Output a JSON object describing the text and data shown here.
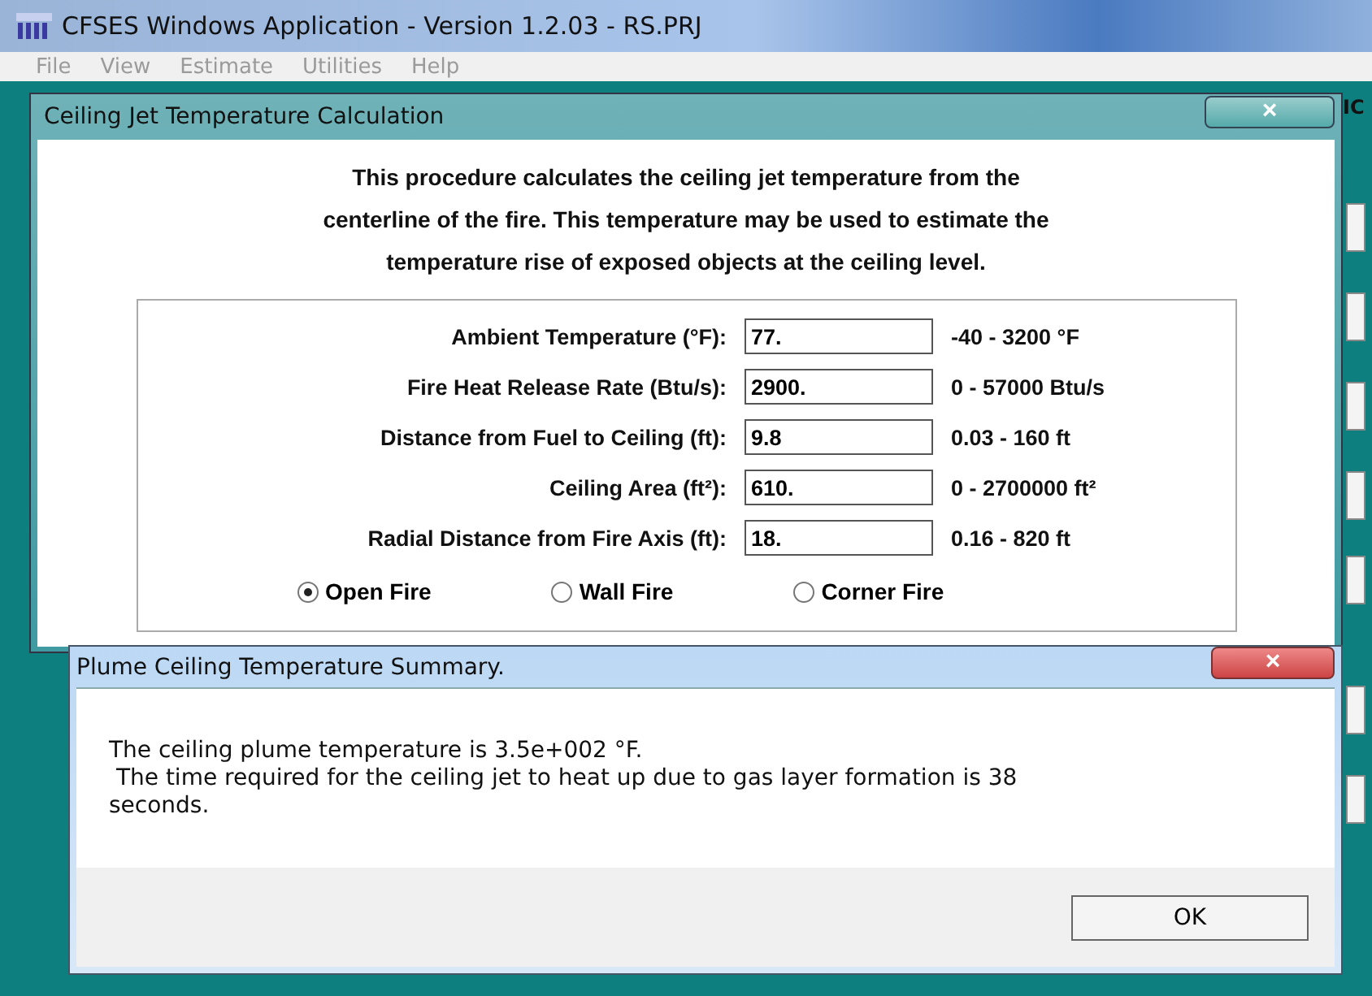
{
  "window": {
    "title": "CFSES Windows Application - Version 1.2.03 - RS.PRJ"
  },
  "menu": [
    {
      "label": "File",
      "disabled": true
    },
    {
      "label": "View",
      "disabled": true
    },
    {
      "label": "Estimate",
      "disabled": true
    },
    {
      "label": "Utilities",
      "disabled": true
    },
    {
      "label": "Help",
      "disabled": true
    }
  ],
  "background": {
    "partial_text": "IC"
  },
  "dialog": {
    "title": "Ceiling Jet Temperature Calculation",
    "close": "×",
    "intro": [
      "This procedure calculates the ceiling jet temperature from the",
      "centerline of the fire.  This temperature may be used to estimate the",
      "temperature rise of exposed objects at the ceiling level."
    ],
    "fields": [
      {
        "label": "Ambient Temperature (°F):",
        "value": "77.",
        "range": "-40 - 3200 °F"
      },
      {
        "label": "Fire Heat Release Rate (Btu/s):",
        "value": "2900.",
        "range": "0 - 57000 Btu/s"
      },
      {
        "label": "Distance from Fuel to Ceiling (ft):",
        "value": "9.8",
        "range": "0.03 - 160 ft"
      },
      {
        "label": "Ceiling Area (ft²):",
        "value": "610.",
        "range": "0 - 2700000 ft²"
      },
      {
        "label": "Radial Distance from Fire Axis (ft):",
        "value": "18.",
        "range": "0.16 - 820 ft"
      }
    ],
    "fire_types": [
      {
        "label": "Open Fire",
        "selected": true
      },
      {
        "label": "Wall Fire",
        "selected": false
      },
      {
        "label": "Corner Fire",
        "selected": false
      }
    ]
  },
  "message": {
    "title": "Plume Ceiling Temperature Summary.",
    "close": "×",
    "lines": [
      "The ceiling plume temperature is 3.5e+002 °F.",
      " The time required for the ceiling jet to heat up due to gas layer formation is 38",
      "seconds."
    ],
    "button": "OK"
  }
}
